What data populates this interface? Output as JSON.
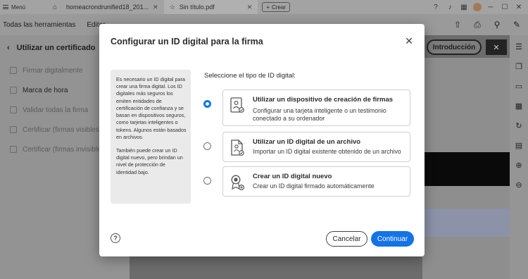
{
  "titlebar": {
    "menu_label": "Menú",
    "tabs": [
      {
        "label": "homeacrondrunified18_201..."
      },
      {
        "label": "Sin título.pdf"
      }
    ],
    "new_tab_label": "Crear"
  },
  "toolbar": {
    "items": [
      "Todas las herramientas",
      "Editar"
    ]
  },
  "left_panel": {
    "title": "Utilizar un certificado",
    "items": [
      {
        "label": "Firmar digitalmente"
      },
      {
        "label": "Marca de hora"
      },
      {
        "label": "Validar todas la firma"
      },
      {
        "label": "Certificar (firmas visibles)"
      },
      {
        "label": "Certificar (firmas invisibles)"
      }
    ]
  },
  "intro_button_label": "Introducción",
  "dialog": {
    "title": "Configurar un ID digital para la firma",
    "info_paragraph_1": "Es necesario un ID digital para crear una firma digital. Los ID digitales más seguros los emiten entidades de certificación de confianza y se basan en dispositivos seguros, como tarjetas inteligentes o tokens. Algunos están basados en archivos.",
    "info_paragraph_2": "También puede crear un ID digital nuevo, pero brindan un nivel de protección de identidad bajo.",
    "select_label": "Seleccione el tipo de ID digital:",
    "options": [
      {
        "title": "Utilizar un dispositivo de creación de firmas",
        "description": "Configurar una tarjeta inteligente o un testimonio conectado a su ordenador",
        "selected": true
      },
      {
        "title": "Utilizar un ID digital de un archivo",
        "description": "Importar un ID digital existente obtenido de un archivo",
        "selected": false
      },
      {
        "title": "Crear un ID digital nuevo",
        "description": "Crear un ID digital firmado automáticamente",
        "selected": false
      }
    ],
    "cancel_label": "Cancelar",
    "continue_label": "Continuar",
    "accent_color": "#1473e6"
  }
}
